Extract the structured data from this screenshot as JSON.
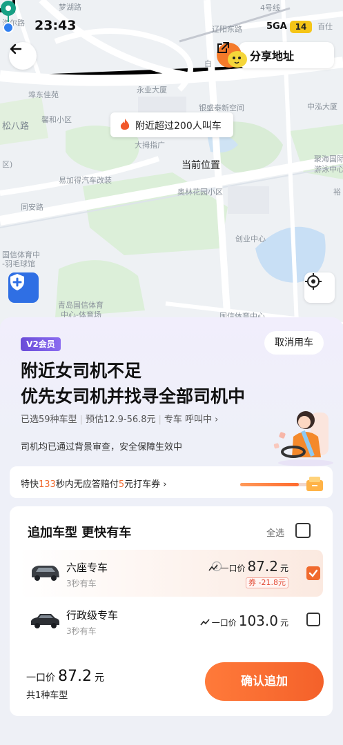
{
  "status_bar": {
    "time": "23:43",
    "network": "5GA",
    "battery": "14"
  },
  "map": {
    "labels": {
      "top_road": "梦湖路",
      "top_left": "海尔路",
      "line4": "4号线",
      "station": "辽阳东路",
      "baiyi": "百仕",
      "bai": "白",
      "huangdao": "埠东佳苑",
      "yongye": "永业大厦",
      "yinzuo": "银盛泰新空间",
      "zhongxin": "中泓大厦",
      "xiaoqu": "馨和小区",
      "songba": "松八路",
      "tuotuo": "大拇指广",
      "qu": "区)",
      "yida": "易加得汽车改装",
      "aolin": "奥林花园小区",
      "jucheng": "聚海国际",
      "youyong": "游泳中心",
      "yu": "裕",
      "tongan": "同安路",
      "chuangye": "创业中心",
      "xinxin": "国信体育中",
      "yumao": "-羽毛球馆",
      "qingdao": "青岛国信体育",
      "zhongxin2": "中心-体育场",
      "guoxin3": "国信体育中心"
    },
    "callout": "附近超过200人叫车",
    "current_location": "当前位置",
    "share_label": "分享地址"
  },
  "panel": {
    "vip_badge": "V2会员",
    "cancel": "取消用车",
    "headline_1": "附近女司机不足",
    "headline_2": "优先女司机并找寻全部司机中",
    "sub_selected": "已选59种车型",
    "sub_estimate": "预估12.9-56.8元",
    "sub_type": "专车 呼叫中 ›",
    "safety": "司机均已通过背景审查，安全保障生效中",
    "compensation": {
      "pre": "特快",
      "seconds": "133",
      "mid": "秒内无应答赔付",
      "amount": "5",
      "post": "元打车券 ›"
    },
    "compensation_progress": 0.85,
    "options": {
      "title": "追加车型 更快有车",
      "select_all": "全选",
      "items": [
        {
          "name": "六座专车",
          "eta": "3秒有车",
          "price_label": "一口价",
          "price": "87.2",
          "unit": "元",
          "coupon": "券 -21.8元",
          "checked": true
        },
        {
          "name": "行政级专车",
          "eta": "3秒有车",
          "price_label": "一口价",
          "price": "103.0",
          "unit": "元",
          "coupon": "",
          "checked": false
        }
      ]
    },
    "total": {
      "label": "一口价",
      "price": "87.2",
      "unit": "元",
      "count": "共1种车型"
    },
    "confirm": "确认追加"
  },
  "colors": {
    "accent": "#f06a2e",
    "vip": "#6a4cd8",
    "safety_blue": "#2f6fe4",
    "pin_green": "#17a085"
  }
}
